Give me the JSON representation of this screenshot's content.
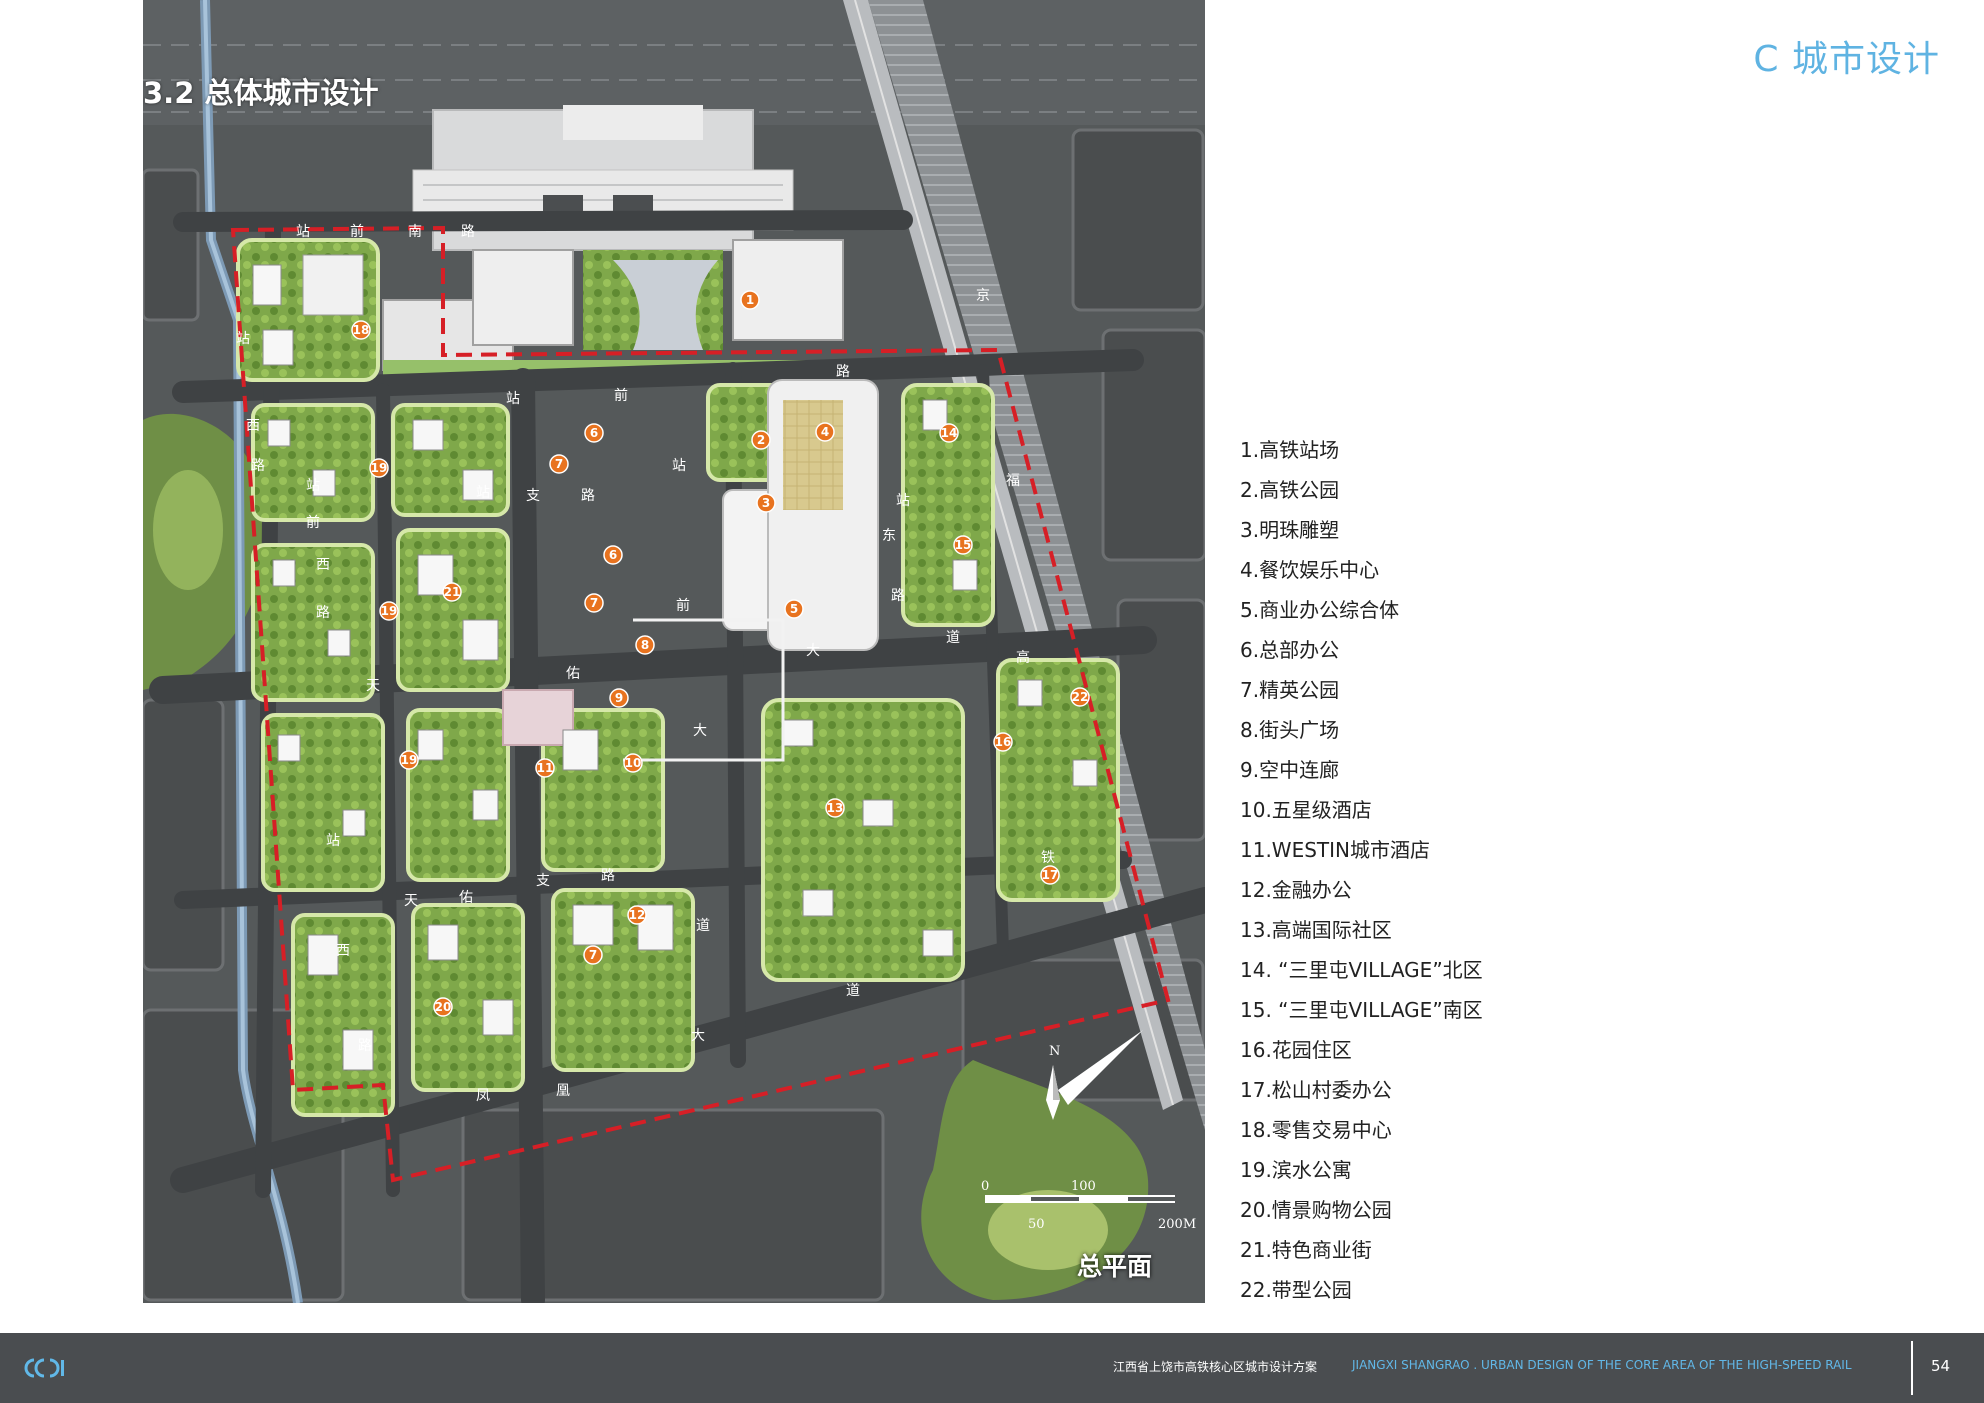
{
  "header": {
    "section_heading": "C 城市设计"
  },
  "map": {
    "title": "3.2 总体城市设计",
    "caption": "总平面",
    "north_label": "N",
    "scale_labels": [
      "0",
      "100",
      "50",
      "200M"
    ],
    "road_labels": [
      "站",
      "前",
      "南",
      "路",
      "站",
      "前",
      "路",
      "站",
      "西",
      "路",
      "站",
      "前",
      "西",
      "路",
      "站",
      "支",
      "路",
      "站",
      "前",
      "大",
      "道",
      "站",
      "东",
      "路",
      "天",
      "佑",
      "大",
      "道",
      "天",
      "佑",
      "支",
      "路",
      "凤",
      "凰",
      "大",
      "道",
      "站",
      "西",
      "路",
      "京",
      "福",
      "高",
      "铁"
    ],
    "markers": [
      "1",
      "2",
      "3",
      "4",
      "5",
      "6",
      "6",
      "7",
      "7",
      "7",
      "8",
      "9",
      "10",
      "11",
      "12",
      "13",
      "14",
      "15",
      "16",
      "17",
      "18",
      "19",
      "19",
      "19",
      "20",
      "21",
      "22"
    ]
  },
  "legend": {
    "items": [
      "1.高铁站场",
      "2.高铁公园",
      "3.明珠雕塑",
      "4.餐饮娱乐中心",
      "5.商业办公综合体",
      "6.总部办公",
      "7.精英公园",
      "8.街头广场",
      "9.空中连廊",
      "10.五星级酒店",
      "11.WESTIN城市酒店",
      "12.金融办公",
      "13.高端国际社区",
      "14. “三里屯VILLAGE”北区",
      "15. “三里屯VILLAGE”南区",
      "16.花园住区",
      "17.松山村委办公",
      "18.零售交易中心",
      "19.滨水公寓",
      "20.情景购物公园",
      "21.特色商业街",
      "22.带型公园"
    ]
  },
  "footer": {
    "logo": "ccdi-logo",
    "title_cn": "江西省上饶市高铁核心区城市设计方案",
    "title_en": "JIANGXI SHANGRAO . URBAN DESIGN OF THE CORE AREA OF THE HIGH-SPEED RAIL",
    "page_number": "54"
  },
  "colors": {
    "accent": "#5fb3e2",
    "footer_bg": "#4a4d50",
    "marker": "#e8731f",
    "boundary": "#d61f26",
    "block_green": "#8fb84e",
    "road": "#55595a"
  }
}
